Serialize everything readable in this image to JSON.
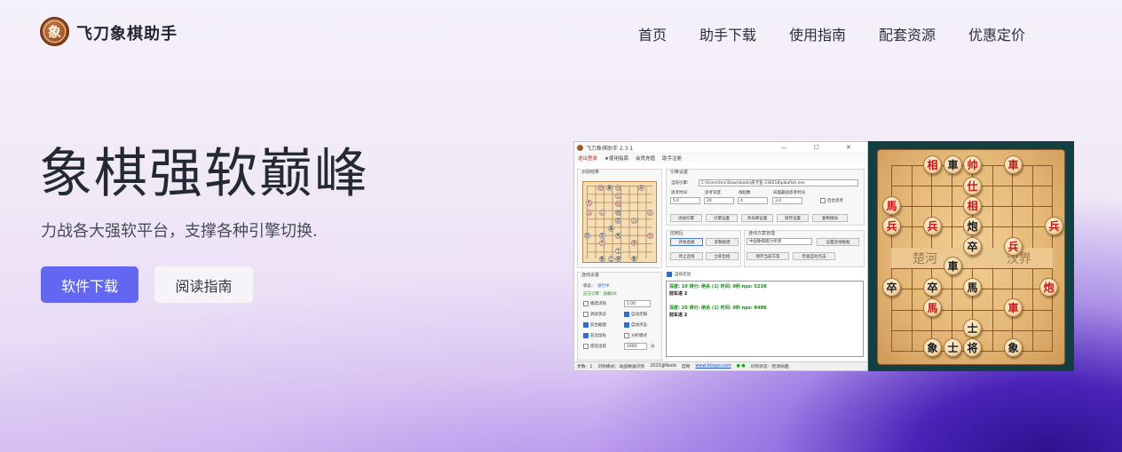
{
  "brand": {
    "name": "飞刀象棋助手",
    "logo_char": "象"
  },
  "nav": [
    {
      "label": "首页"
    },
    {
      "label": "助手下载"
    },
    {
      "label": "使用指南"
    },
    {
      "label": "配套资源"
    },
    {
      "label": "优惠定价"
    }
  ],
  "hero": {
    "title": "象棋强软巅峰",
    "subtitle": "力战各大强软平台，支撑各种引擎切换.",
    "download_button": "软件下载",
    "guide_button": "阅读指南"
  },
  "app_screenshot": {
    "window_title": "飞刀象棋助手 2.3.1",
    "window_buttons": "— ☐ ✕",
    "menu": [
      "退出登录",
      "★使用指南",
      "会员充值",
      "助手注册"
    ],
    "recognition_title": "识别结果",
    "engine_panel_title": "引擎设置",
    "engine_path_label": "当前引擎:",
    "engine_path": "C:\\Users\\lmc\\Downloads\\皮卡鱼 230218\\pikafish.exe",
    "param_labels": [
      "思考时间",
      "思考深度",
      "线程数",
      "局面最短思考时间"
    ],
    "param_values": [
      "5.0",
      "20",
      "4",
      "3.0"
    ],
    "background_think": "后台思考",
    "engine_buttons": [
      "添加引擎",
      "引擎设置",
      "开局库设置",
      "保存设置",
      "复制棋局"
    ],
    "control_title": "控制区",
    "control_buttons": [
      "开始连棋",
      "求救棋谱",
      "停止连线",
      "立即出招"
    ],
    "scheme_title": "连线方案管理",
    "scheme_selected": "中国象棋棋力评测",
    "scheme_buttons": [
      "设置连线框框",
      "保存当前方案",
      "检查自动点击"
    ],
    "auto_move": "自动走动",
    "link_settings_title": "连线设置",
    "status_label": "状态：",
    "status_value": "进行中",
    "engine_state": "前方引擎：加载OK",
    "options_left": [
      "棋谱识别",
      "调试状态",
      "前台截图",
      "前台鼠标",
      "提前出招"
    ],
    "options_right": [
      "自动走棋",
      "自动点击",
      "分析模式"
    ],
    "spin_value_1": "1.00",
    "spin_value_2": "2000",
    "spin_unit": "分",
    "log_lines": [
      {
        "text": "深度: 10 得分: 绝杀 (1) 时间: 0秒 nps: 521K",
        "kind": "g"
      },
      {
        "text": "前车进 2",
        "kind": "k"
      },
      {
        "text": "深度: 20 得分: 绝杀 (1) 时间: 0秒 nps: 848K",
        "kind": "g"
      },
      {
        "text": "前车进 2",
        "kind": "k"
      }
    ],
    "statusbar": {
      "moves": "步数：1",
      "mode": "识别模式：动画精准识别",
      "copyright": "2023@Noob",
      "site_label": "官网",
      "site": "www.fdxqzs.com",
      "detect": "识别状态：检测局面"
    }
  },
  "board": {
    "river_left": "楚河",
    "river_right": "汉界",
    "pieces": [
      {
        "char": "相",
        "side": "r"
      },
      {
        "char": "車",
        "side": "b"
      },
      {
        "char": "帅",
        "side": "r"
      },
      {
        "char": "車",
        "side": "r"
      },
      {
        "char": "仕",
        "side": "r"
      },
      {
        "char": "馬",
        "side": "r"
      },
      {
        "char": "相",
        "side": "r"
      },
      {
        "char": "兵",
        "side": "r"
      },
      {
        "char": "兵",
        "side": "r"
      },
      {
        "char": "炮",
        "side": "b"
      },
      {
        "char": "兵",
        "side": "r"
      },
      {
        "char": "卒",
        "side": "b"
      },
      {
        "char": "兵",
        "side": "r"
      },
      {
        "char": "車",
        "side": "b"
      },
      {
        "char": "卒",
        "side": "b"
      },
      {
        "char": "卒",
        "side": "b"
      },
      {
        "char": "馬",
        "side": "b"
      },
      {
        "char": "炮",
        "side": "r"
      },
      {
        "char": "馬",
        "side": "r"
      },
      {
        "char": "車",
        "side": "r"
      },
      {
        "char": "士",
        "side": "b"
      },
      {
        "char": "象",
        "side": "b"
      },
      {
        "char": "士",
        "side": "b"
      },
      {
        "char": "将",
        "side": "b"
      },
      {
        "char": "象",
        "side": "b"
      }
    ]
  }
}
